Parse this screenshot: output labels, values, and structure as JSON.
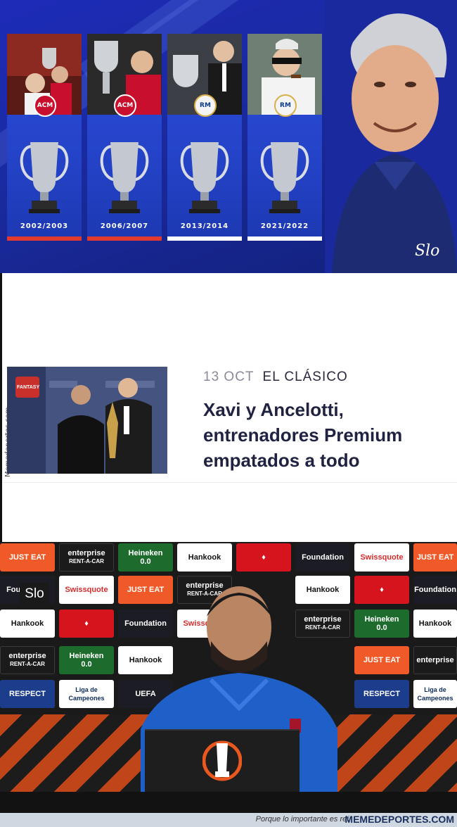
{
  "top": {
    "cards": [
      {
        "year": "2002/2003",
        "club": "milan",
        "crest": "ACM"
      },
      {
        "year": "2006/2007",
        "club": "milan",
        "crest": "ACM"
      },
      {
        "year": "2013/2014",
        "club": "madrid",
        "crest": "RM"
      },
      {
        "year": "2021/2022",
        "club": "madrid",
        "crest": "RM"
      }
    ],
    "signature": "Slo",
    "trophy_icon": "champions-league-trophy-icon"
  },
  "article": {
    "date": "13 OCT",
    "category": "EL CLÁSICO",
    "headline": "Xavi y Ancelotti, entrenadores Premium empatados a todo",
    "watermark": "Memedeportes.com",
    "thumb_badge": "FANTASY"
  },
  "press": {
    "watermark": "Slo",
    "sponsors": {
      "just_eat": "JUST EAT",
      "enterprise": "enterprise",
      "rent": "RENT-A-CAR",
      "heineken": "Heineken",
      "heineken_sub": "0.0",
      "hankook": "Hankook",
      "swissquote": "Swissquote",
      "foundation": "Foundation",
      "respect": "RESPECT",
      "liga": "Liga de Campeones",
      "uefa": "UEFA"
    }
  },
  "footer": {
    "tagline": "Porque lo importante es reír",
    "site": "MEMEDEPORTES.COM"
  }
}
